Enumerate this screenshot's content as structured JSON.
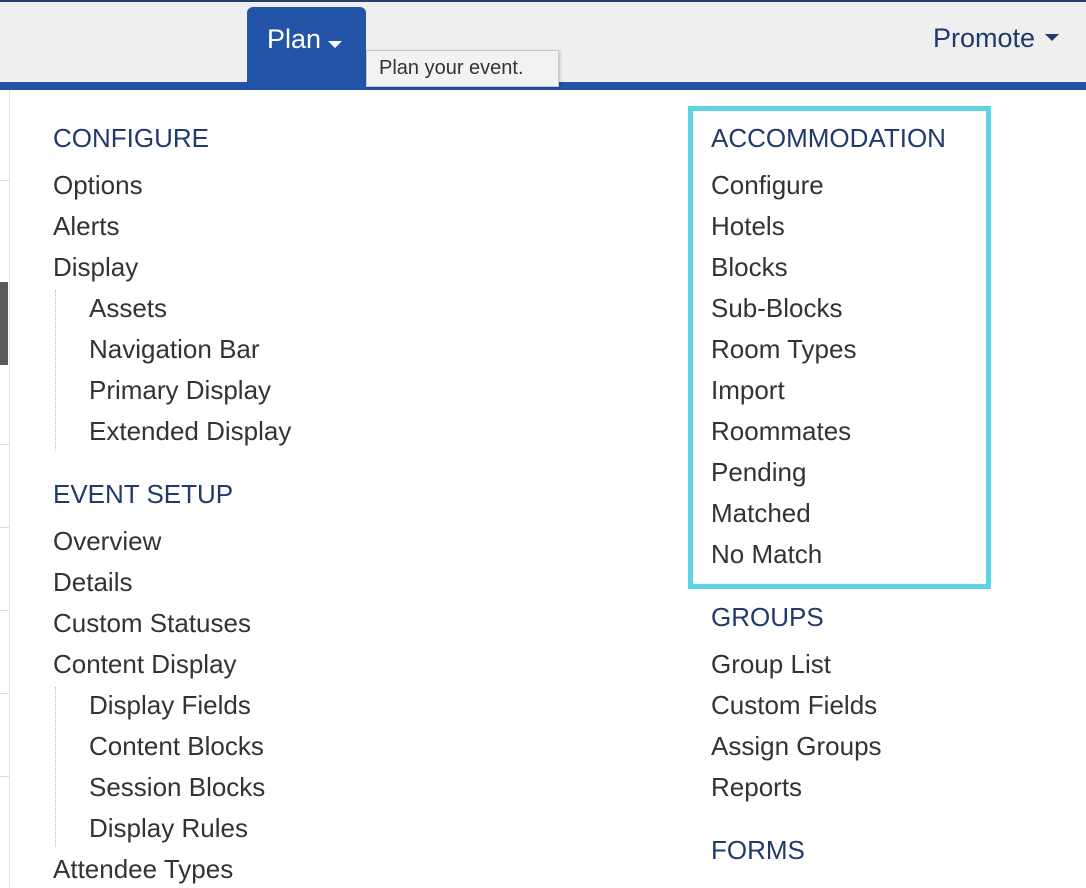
{
  "topbar": {
    "plan_label": "Plan",
    "plan_tooltip": "Plan your event.",
    "promote_label": "Promote"
  },
  "menu": {
    "configure": {
      "heading": "CONFIGURE",
      "items": [
        "Options",
        "Alerts",
        "Display"
      ],
      "display_sub": [
        "Assets",
        "Navigation Bar",
        "Primary Display",
        "Extended Display"
      ]
    },
    "event_setup": {
      "heading": "EVENT SETUP",
      "items": [
        "Overview",
        "Details",
        "Custom Statuses",
        "Content Display"
      ],
      "content_display_sub": [
        "Display Fields",
        "Content Blocks",
        "Session Blocks",
        "Display Rules"
      ],
      "after": [
        "Attendee Types"
      ]
    },
    "accommodation": {
      "heading": "ACCOMMODATION",
      "items": [
        "Configure",
        "Hotels",
        "Blocks",
        "Sub-Blocks",
        "Room Types",
        "Import",
        "Roommates",
        "Pending",
        "Matched",
        "No Match"
      ]
    },
    "groups": {
      "heading": "GROUPS",
      "items": [
        "Group List",
        "Custom Fields",
        "Assign Groups",
        "Reports"
      ]
    },
    "forms": {
      "heading": "FORMS"
    }
  },
  "colors": {
    "nav_blue": "#2454a8",
    "heading_navy": "#1f3a6b",
    "highlight_cyan": "#5dd3e3"
  }
}
